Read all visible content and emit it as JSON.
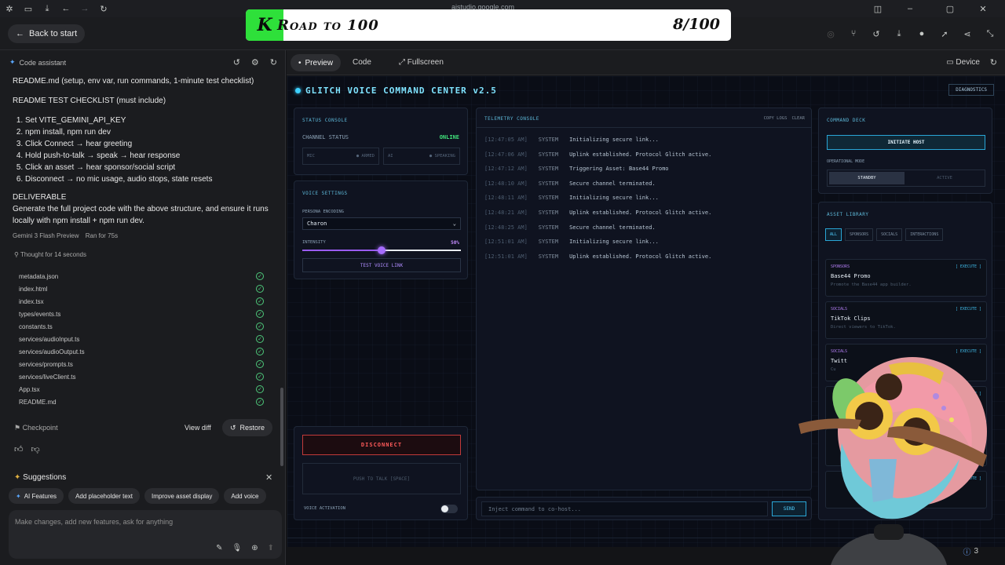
{
  "browser": {
    "url": "aistudio.google.com"
  },
  "banner": {
    "k": "K",
    "title": "Road to 100",
    "count": "8/100"
  },
  "header": {
    "back_label": "Back to start"
  },
  "assistant": {
    "title": "Code assistant",
    "readme_line": "README.md (setup, env var, run commands, 1-minute test checklist)",
    "checklist_title": "README TEST CHECKLIST (must include)",
    "steps": [
      "Set VITE_GEMINI_API_KEY",
      "npm install, npm run dev",
      "Click Connect → hear greeting",
      "Hold push-to-talk → speak → hear response",
      "Click an asset → hear sponsor/social script",
      "Disconnect → no mic usage, audio stops, state resets"
    ],
    "deliverable_title": "DELIVERABLE",
    "deliverable_text": "Generate the full project code with the above structure, and ensure it runs locally with npm install + npm run dev.",
    "model": "Gemini 3 Flash Preview",
    "ran_for": "Ran for 75s",
    "thought": "Thought for 14 seconds",
    "files": [
      "metadata.json",
      "index.html",
      "index.tsx",
      "types/events.ts",
      "constants.ts",
      "services/audioInput.ts",
      "services/audioOutput.ts",
      "services/prompts.ts",
      "services/liveClient.ts",
      "App.tsx",
      "README.md"
    ],
    "checkpoint": "Checkpoint",
    "view_diff": "View diff",
    "restore": "Restore",
    "suggestions_title": "Suggestions",
    "suggestions": [
      "AI Features",
      "Add placeholder text",
      "Improve asset display",
      "Add voice"
    ],
    "prompt_placeholder": "Make changes, add new features, ask for anything"
  },
  "preview_tabs": {
    "preview": "Preview",
    "code": "Code",
    "fullscreen": "Fullscreen",
    "device": "Device"
  },
  "app": {
    "title": "GLITCH VOICE COMMAND CENTER v2.5",
    "diagnostics": "DIAGNOSTICS",
    "status_console": {
      "label": "STATUS CONSOLE",
      "channel_label": "CHANNEL STATUS",
      "channel_value": "ONLINE",
      "mic_label": "MIC",
      "mic_state": "● ARMED",
      "ai_label": "AI",
      "ai_state": "● SPEAKING"
    },
    "voice_settings": {
      "label": "VOICE SETTINGS",
      "persona_label": "PERSONA ENCODING",
      "persona_value": "Charon",
      "intensity_label": "INTENSITY",
      "intensity_value": "50%",
      "intensity_level": 0.5,
      "test_button": "TEST VOICE LINK"
    },
    "controls": {
      "disconnect": "DISCONNECT",
      "push_to_talk": "PUSH TO TALK [SPACE]",
      "voice_activation": "VOICE ACTIVATION"
    },
    "telemetry": {
      "label": "TELEMETRY CONSOLE",
      "copy": "COPY LOGS",
      "clear": "CLEAR",
      "logs": [
        {
          "time": "[12:47:05 AM]",
          "src": "SYSTEM",
          "msg": "Initializing secure link..."
        },
        {
          "time": "[12:47:06 AM]",
          "src": "SYSTEM",
          "msg": "Uplink established. Protocol Glitch active."
        },
        {
          "time": "[12:47:12 AM]",
          "src": "SYSTEM",
          "msg": "Triggering Asset: Base44 Promo"
        },
        {
          "time": "[12:48:10 AM]",
          "src": "SYSTEM",
          "msg": "Secure channel terminated."
        },
        {
          "time": "[12:48:11 AM]",
          "src": "SYSTEM",
          "msg": "Initializing secure link..."
        },
        {
          "time": "[12:48:21 AM]",
          "src": "SYSTEM",
          "msg": "Uplink established. Protocol Glitch active."
        },
        {
          "time": "[12:48:25 AM]",
          "src": "SYSTEM",
          "msg": "Secure channel terminated."
        },
        {
          "time": "[12:51:01 AM]",
          "src": "SYSTEM",
          "msg": "Initializing secure link..."
        },
        {
          "time": "[12:51:01 AM]",
          "src": "SYSTEM",
          "msg": "Uplink established. Protocol Glitch active."
        }
      ],
      "input_placeholder": "Inject command to co-host...",
      "send": "SEND"
    },
    "command_deck": {
      "label": "COMMAND DECK",
      "initiate": "INITIATE HOST",
      "mode_label": "OPERATIONAL MODE",
      "standby": "STANDBY",
      "active": "ACTIVE"
    },
    "asset_library": {
      "label": "ASSET LIBRARY",
      "filters": [
        "ALL",
        "SPONSORS",
        "SOCIALS",
        "INTERACTIONS"
      ],
      "execute": "[ EXECUTE ]",
      "assets": [
        {
          "cat": "SPONSORS",
          "name": "Base44 Promo",
          "desc": "Promote the Base44 app builder."
        },
        {
          "cat": "SOCIALS",
          "name": "TikTok Clips",
          "desc": "Direct viewers to TikTok."
        },
        {
          "cat": "SOCIALS",
          "name": "Twitt",
          "desc": "Cu"
        }
      ]
    }
  },
  "status_count": "3"
}
